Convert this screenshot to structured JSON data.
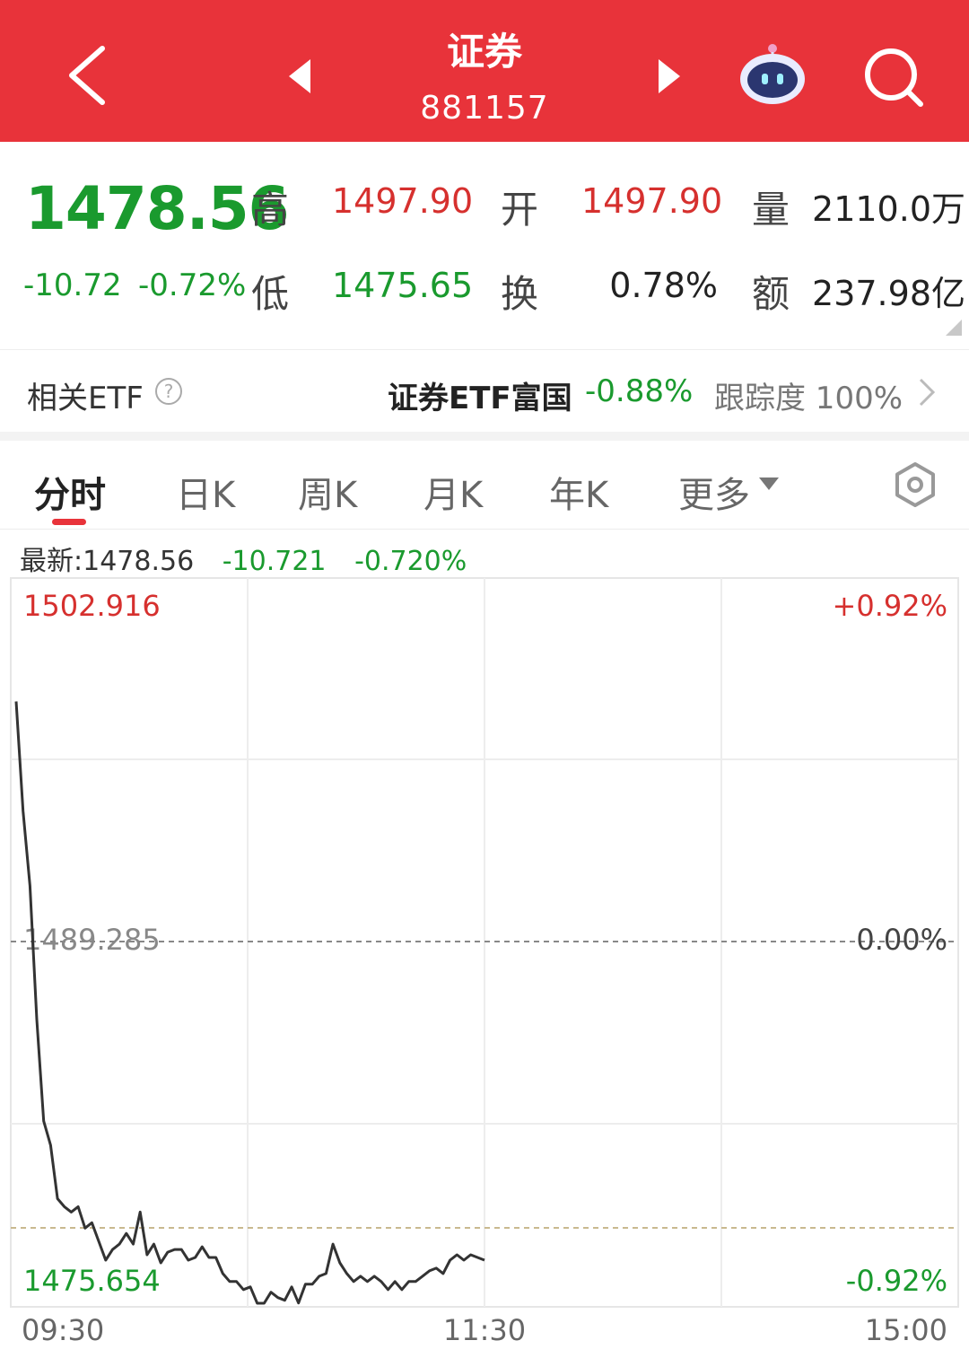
{
  "header": {
    "title": "证券",
    "code": "881157",
    "background_color": "#e8333a",
    "icons": [
      "back-arrow-icon",
      "prev-triangle-icon",
      "next-triangle-icon",
      "robot-assistant-icon",
      "search-icon"
    ]
  },
  "quote": {
    "price": "1478.56",
    "change": "-10.72",
    "change_pct": "-0.72%",
    "high_label": "高",
    "high": "1497.90",
    "open_label": "开",
    "open": "1497.90",
    "volume_label": "量",
    "volume": "2110.0万",
    "low_label": "低",
    "low": "1475.65",
    "turnover_label": "换",
    "turnover": "0.78%",
    "amount_label": "额",
    "amount": "237.98亿"
  },
  "etf": {
    "label": "相关ETF",
    "name": "证券ETF富国",
    "change": "-0.88%",
    "tracking": "跟踪度 100%"
  },
  "tabs": [
    {
      "label": "分时",
      "active": true
    },
    {
      "label": "日K"
    },
    {
      "label": "周K"
    },
    {
      "label": "月K"
    },
    {
      "label": "年K"
    },
    {
      "label": "更多"
    }
  ],
  "latest": {
    "label": "最新:1478.56",
    "change": "-10.721",
    "change_pct": "-0.720%"
  },
  "chart_data": {
    "type": "line",
    "y_max": 1502.916,
    "y_min": 1475.654,
    "y_ref": 1489.285,
    "y_max_label": "1502.916",
    "y_min_label": "1475.654",
    "y_ref_label": "1489.285",
    "pct_max_label": "+0.92%",
    "pct_ref_label": "0.00%",
    "pct_min_label": "-0.92%",
    "x_labels": [
      "09:30",
      "11:30"
    ],
    "x_end_label": "15:00",
    "series": [
      {
        "values": [
          1498.3,
          1494.2,
          1491.4,
          1486.4,
          1482.6,
          1481.7,
          1479.7,
          1479.4,
          1479.2,
          1479.4,
          1478.6,
          1478.8,
          1478.1,
          1477.4,
          1477.8,
          1478.0,
          1478.4,
          1478.0,
          1479.2,
          1477.6,
          1478.0,
          1477.3,
          1477.7,
          1477.8,
          1477.8,
          1477.4,
          1477.5,
          1477.9,
          1477.5,
          1477.5,
          1476.9,
          1476.6,
          1476.6,
          1476.3,
          1476.4,
          1475.7,
          1475.7,
          1476.2,
          1476.0,
          1475.9,
          1476.4,
          1475.8,
          1476.5,
          1476.5,
          1476.8,
          1476.9,
          1478.0,
          1477.3,
          1476.9,
          1476.6,
          1476.8,
          1476.6,
          1476.8,
          1476.6,
          1476.3,
          1476.6,
          1476.3,
          1476.6,
          1476.6,
          1476.8,
          1477.0,
          1477.1,
          1476.9,
          1477.4,
          1477.6,
          1477.4,
          1477.6,
          1477.5,
          1477.4
        ],
        "color": "#333333"
      }
    ],
    "grid": true
  }
}
